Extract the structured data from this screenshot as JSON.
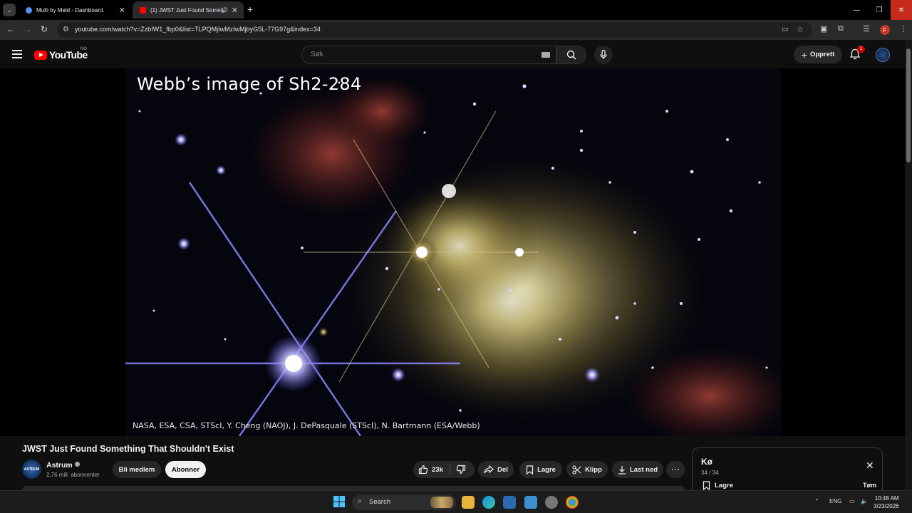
{
  "browser": {
    "tabs": [
      {
        "title": "Multi by Meld - Dashboard.",
        "active": false
      },
      {
        "title": "(1) JWST Just Found Someth",
        "active": true
      }
    ],
    "url": "youtube.com/watch?v=ZzbIW1_fbp0&list=TLPQMjIwMzIwMjbyG5L-77G97g&index=34",
    "profile_initial": "F"
  },
  "youtube": {
    "logo_text": "YouTube",
    "country_code": "NO",
    "search_placeholder": "Søk",
    "create_label": "Opprett",
    "notification_count": "1"
  },
  "video": {
    "overlay_title": "Webb’s image of Sh2-284",
    "credit": "NASA, ESA, CSA, STScI, Y. Cheng (NAOJ), J. DePasquale (STScI), N. Bartmann (ESA/Webb)",
    "title": "JWST Just Found Something That Shouldn't Exist"
  },
  "channel": {
    "name": "Astrum",
    "avatar_text": "ASTRUM",
    "subscribers": "2,76 mill. abonnenter",
    "join_label": "Bli medlem",
    "subscribe_label": "Abonner"
  },
  "actions": {
    "likes": "23k",
    "share": "Del",
    "save": "Lagre",
    "clip": "Klipp",
    "download": "Last ned"
  },
  "queue": {
    "title": "Kø",
    "count": "34 / 34",
    "save_label": "Lagre",
    "clear_label": "Tøm"
  },
  "taskbar": {
    "search_placeholder": "Search",
    "language": "ENG",
    "time": "10:48 AM",
    "date": "3/23/2026"
  },
  "colors": {
    "accent_red": "#ff0000",
    "background": "#0f0f0f",
    "button_bg": "#272727"
  }
}
